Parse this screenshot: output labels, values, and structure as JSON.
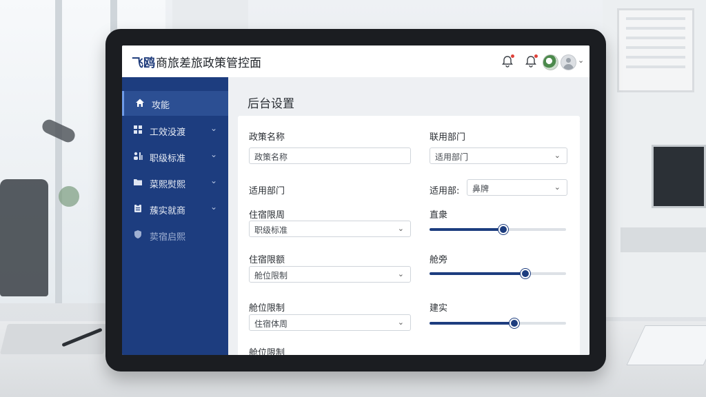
{
  "app": {
    "logo_text": "飞鸥",
    "title_rest": "商旅差旅政策管控面"
  },
  "header": {
    "icons": [
      "bell-icon",
      "bell-icon",
      "avatar",
      "user-avatar"
    ],
    "notification_color": "#e0413a"
  },
  "sidebar": {
    "bg_color": "#1d3d7f",
    "items": [
      {
        "label": "攻能",
        "icon": "home-icon",
        "active": true
      },
      {
        "label": "工效没渡",
        "icon": "grid-icon",
        "chevron": true
      },
      {
        "label": "职级标准",
        "icon": "person-chart-icon",
        "chevron": true
      },
      {
        "label": "菜熙熨熙",
        "icon": "folder-icon",
        "chevron": true
      },
      {
        "label": "蔟实就商",
        "icon": "clipboard-icon",
        "chevron": true
      },
      {
        "label": "荬宿启熙",
        "icon": "shield-icon",
        "muted": true
      }
    ]
  },
  "main": {
    "page_title": "后台设置",
    "left_col": {
      "policy_name_label": "政策名称",
      "policy_name_placeholder": "政策名称",
      "apply_dept_label": "适用部门",
      "lodging_limit_label": "住宿限周",
      "lodging_limit_value": "职级标准",
      "lodging_amount_label": "住宿限额",
      "lodging_amount_value": "舱位限制",
      "cabin_limit_label": "舱位限制",
      "cabin_limit_value": "住宿体周",
      "cabin_limit_label_2": "舱位限制"
    },
    "right_col": {
      "dept_label": "联用部门",
      "dept_value": "适用部门",
      "apply_dept_inline_label": "适用部:",
      "apply_dept_inline_value": "鼻牌",
      "slider1_label": "直衆",
      "slider1_level": 0.54,
      "slider2_label": "舱旁",
      "slider2_level": 0.7,
      "slider3_label": "建实",
      "slider3_level": 0.62
    }
  }
}
